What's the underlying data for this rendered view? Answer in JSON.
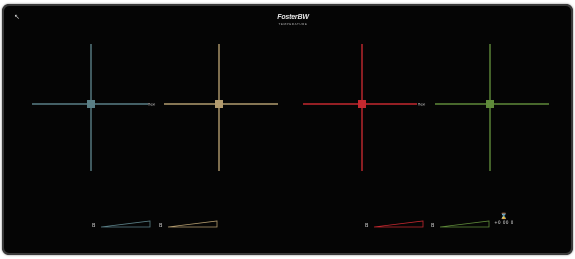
{
  "panel": {
    "corner_icon": "lock-icon",
    "corner_glyph": "↖"
  },
  "logo": {
    "name": "FosterBW",
    "sub": "TEMPERATURE"
  },
  "zones": [
    {
      "id": "zone-1",
      "color": "#5a7f86",
      "label": ""
    },
    {
      "id": "zone-2",
      "color": "#b29b6e",
      "label": ""
    },
    {
      "id": "zone-3",
      "color": "#c4282f",
      "label": ""
    },
    {
      "id": "zone-4",
      "color": "#5f8a3a",
      "label": ""
    }
  ],
  "bridge_labels": {
    "left": "flexi",
    "right": "flexi"
  },
  "sliders": [
    {
      "zone": "zone-1",
      "color": "#5a7f86",
      "icon": "B"
    },
    {
      "zone": "zone-2",
      "color": "#b29b6e",
      "icon": "B"
    },
    {
      "zone": "zone-3",
      "color": "#c4282f",
      "icon": "B"
    },
    {
      "zone": "zone-4",
      "color": "#5f8a3a",
      "icon": "B"
    }
  ],
  "timer": {
    "icon": "timer-icon",
    "icon_glyph": "⌛",
    "controls": "+0 00 0"
  }
}
